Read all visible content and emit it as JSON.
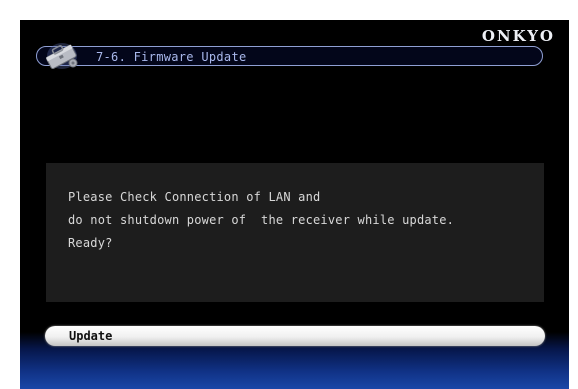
{
  "brand": "ONKYO",
  "header": {
    "title": "7-6. Firmware Update",
    "icon": "settings-toolbox-icon"
  },
  "message": {
    "lines": [
      "Please Check Connection of LAN and",
      "do not shutdown power of  the receiver while update.",
      "Ready?"
    ]
  },
  "actions": {
    "update_label": "Update"
  },
  "colors": {
    "screen_background": "#000000",
    "title_text": "#a9b8ec",
    "title_border": "#8f9fd3",
    "panel_background": "#1d1d1d",
    "message_text": "#d8d8d8",
    "bottom_gradient": "#1a47a8",
    "button_fill": "#f0f0f0"
  }
}
